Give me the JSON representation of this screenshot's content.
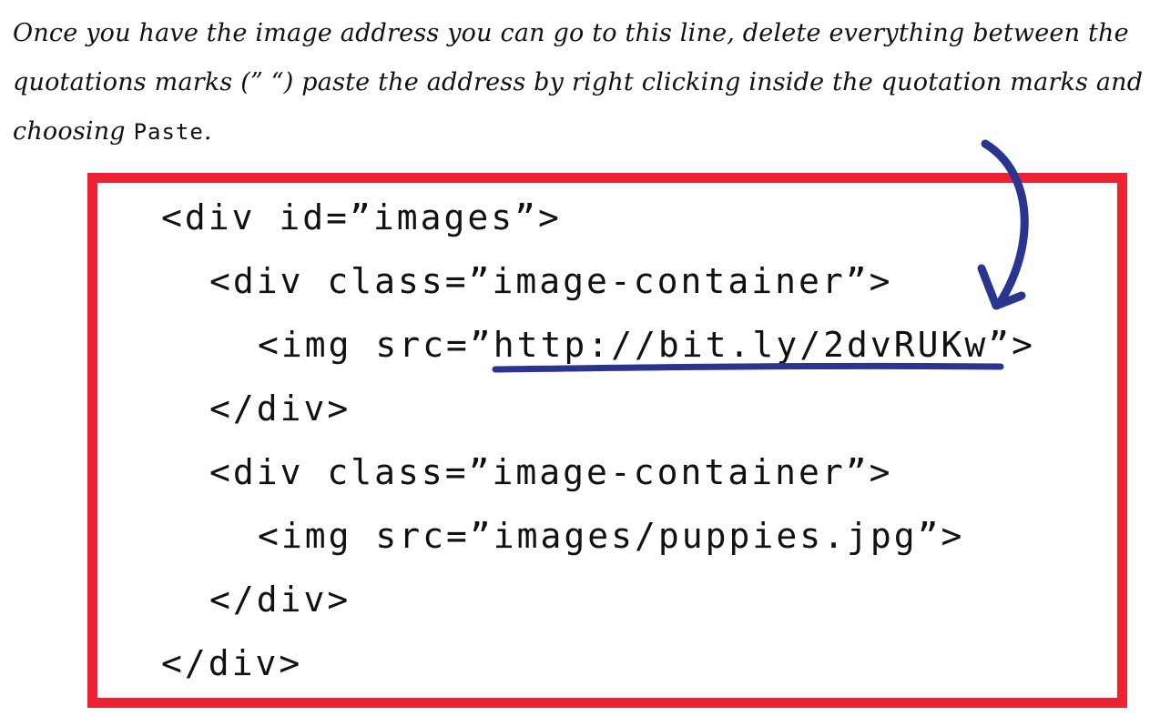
{
  "instructions": {
    "text_before": "Once you have the image address you can go to this line, delete everything between the quotations marks (” “) paste the address by right clicking inside the quotation marks and choosing ",
    "keyword": "Paste",
    "text_after": "."
  },
  "code": {
    "lines": [
      "<div id=”images”>",
      "<div class=”image-container”>",
      "<img src=”http://bit.ly/2dvRUKw”>",
      "</div>",
      "<div class=”image-container”>",
      "<img src=”images/puppies.jpg”>",
      "</div>",
      "</div>"
    ]
  },
  "colors": {
    "box_border": "#ee2233",
    "annotation": "#2a3590",
    "text": "#111111"
  },
  "annotation": {
    "icon": "curved-arrow-icon",
    "underline": "url-underline"
  }
}
